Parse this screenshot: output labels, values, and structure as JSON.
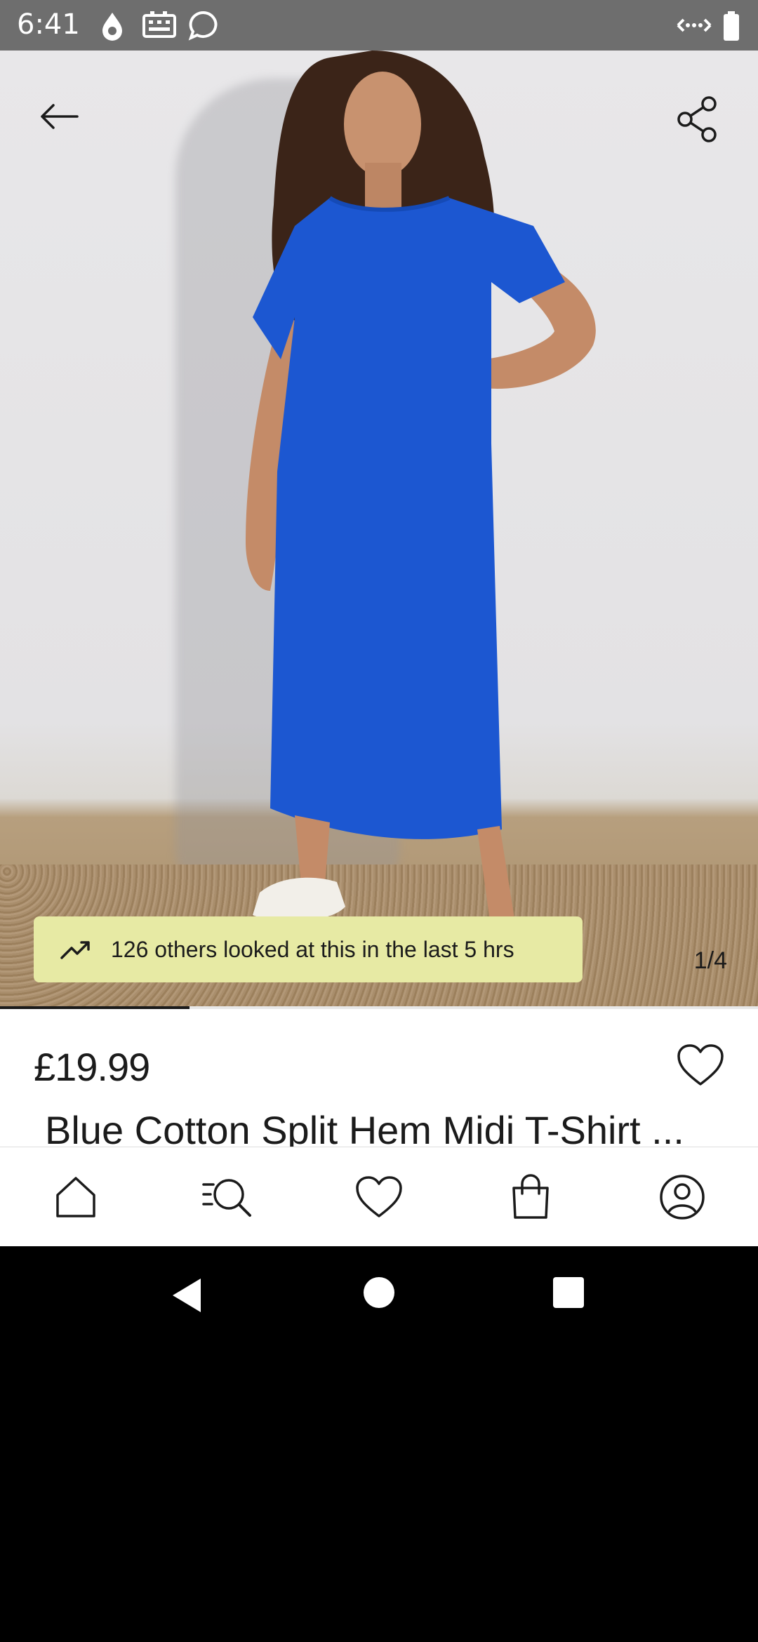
{
  "status_bar": {
    "time": "6:41",
    "left_icons": [
      "water-drop-icon",
      "keyboard-icon",
      "chat-bubble-icon"
    ],
    "right_icons": [
      "data-transfer-icon",
      "battery-icon"
    ]
  },
  "hero": {
    "back_icon": "arrow-left-icon",
    "share_icon": "share-icon",
    "image_description_colors": {
      "dress": "#1c57d1",
      "wall": "#e6e5e7"
    },
    "viewers_text": "126 others looked at this in the last 5 hrs",
    "viewers_pill_color": "#e7eaa4",
    "image_counter": "1/4",
    "gallery_progress": 0.25
  },
  "product": {
    "price": "£19.99",
    "title": "Blue Cotton Split Hem Midi T-Shirt ...",
    "wishlist_icon": "heart-outline-icon"
  },
  "bottom_nav": {
    "items": [
      {
        "icon": "home-icon"
      },
      {
        "icon": "search-list-icon"
      },
      {
        "icon": "heart-icon"
      },
      {
        "icon": "shopping-bag-icon"
      },
      {
        "icon": "account-icon"
      }
    ]
  },
  "system_nav": {
    "buttons": [
      "back-triangle-icon",
      "home-circle-icon",
      "recents-square-icon"
    ]
  }
}
